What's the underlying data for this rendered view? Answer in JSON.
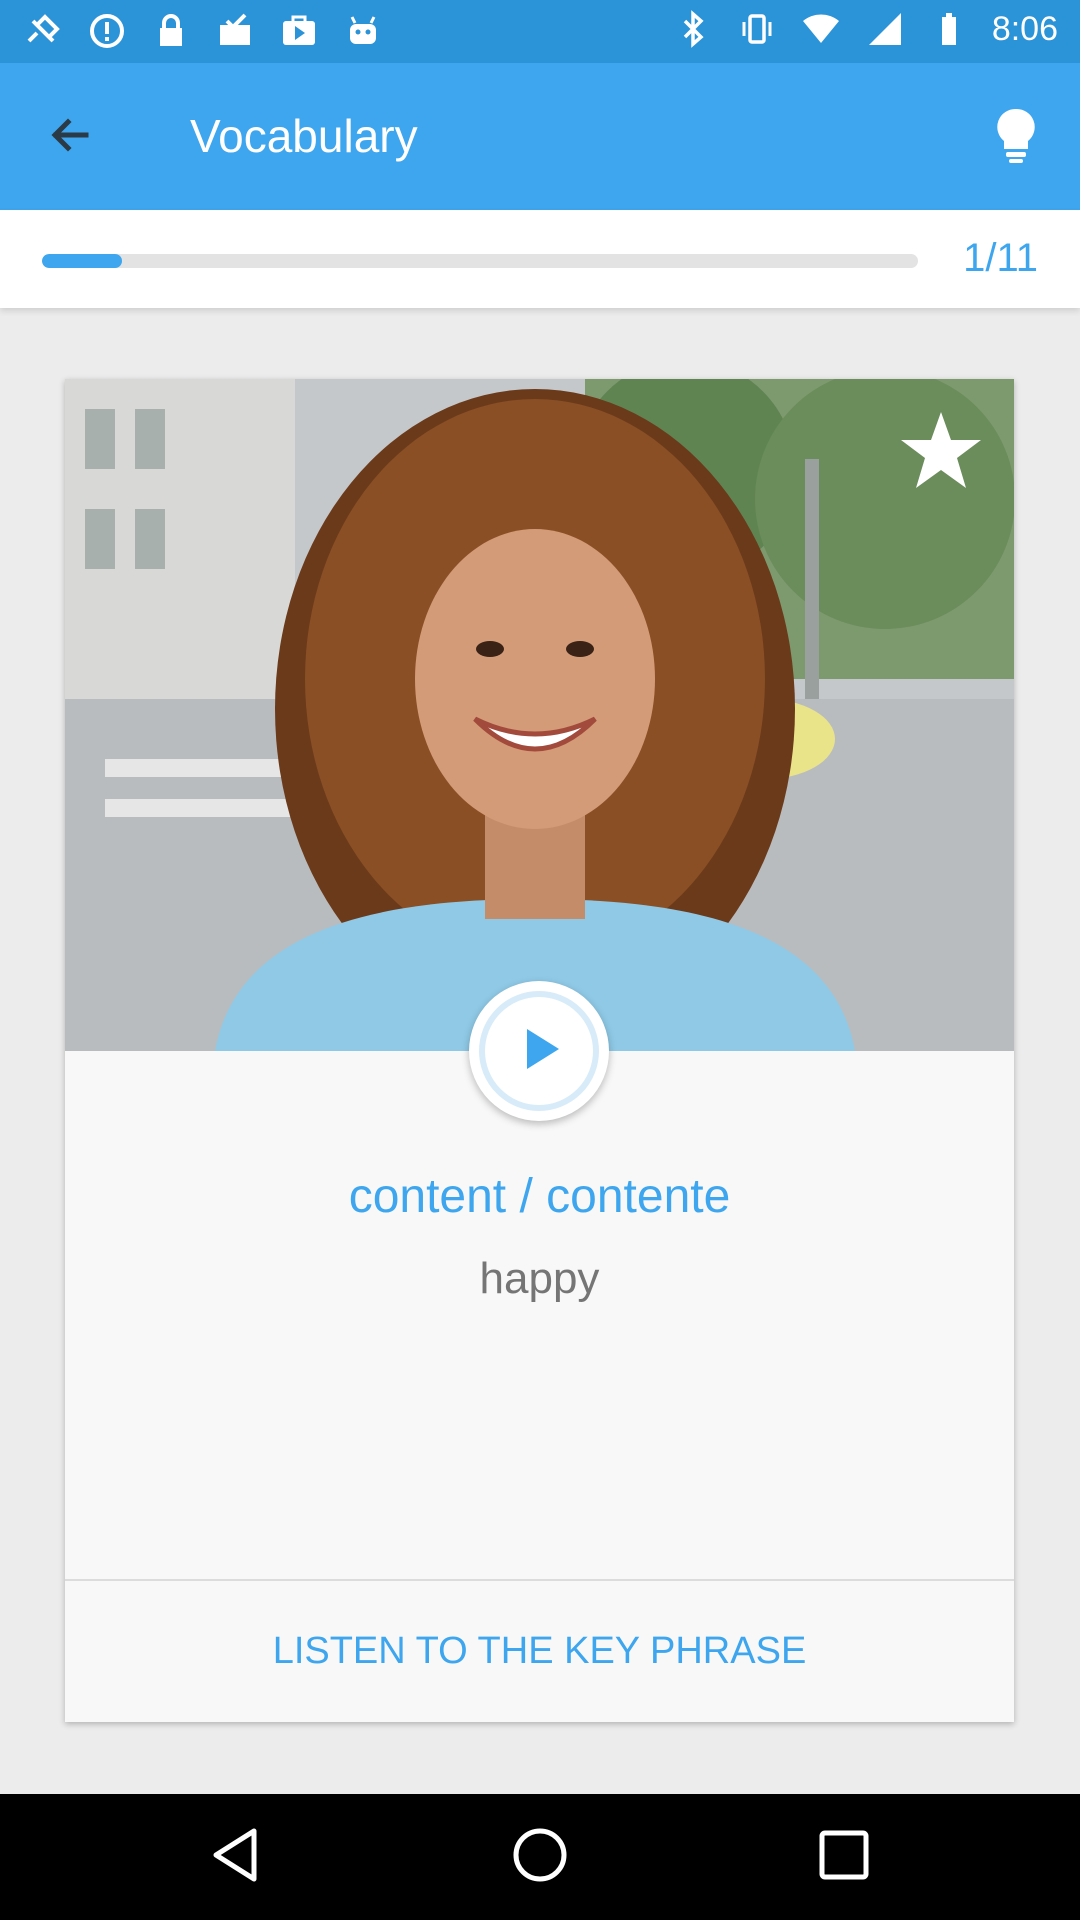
{
  "status_bar": {
    "time": "8:06",
    "icons_left": [
      "fake-gps-icon",
      "alert-circle-icon",
      "lock-icon",
      "mail-check-icon",
      "play-store-icon",
      "android-icon"
    ],
    "icons_right": [
      "bluetooth-icon",
      "vibrate-icon",
      "wifi-icon",
      "signal-icon",
      "battery-icon"
    ]
  },
  "app_bar": {
    "title": "Vocabulary",
    "back_icon": "arrow-back-icon",
    "hint_icon": "lightbulb-icon"
  },
  "progress": {
    "count_label": "1/11",
    "current": 1,
    "total": 11,
    "fraction": 0.0909
  },
  "card": {
    "favorite_icon": "star-icon",
    "play_icon": "play-icon",
    "word": "content / contente",
    "translation": "happy",
    "key_phrase_label": "LISTEN TO THE KEY PHRASE"
  },
  "nav_bar": {
    "buttons": [
      "back-triangle-icon",
      "home-circle-icon",
      "recents-square-icon"
    ]
  },
  "colors": {
    "status_bar": "#2b93d8",
    "app_bar": "#3ea6ee",
    "accent": "#3ea6ee",
    "card_bg": "#f8f8f8",
    "screen_bg": "#ececec"
  }
}
